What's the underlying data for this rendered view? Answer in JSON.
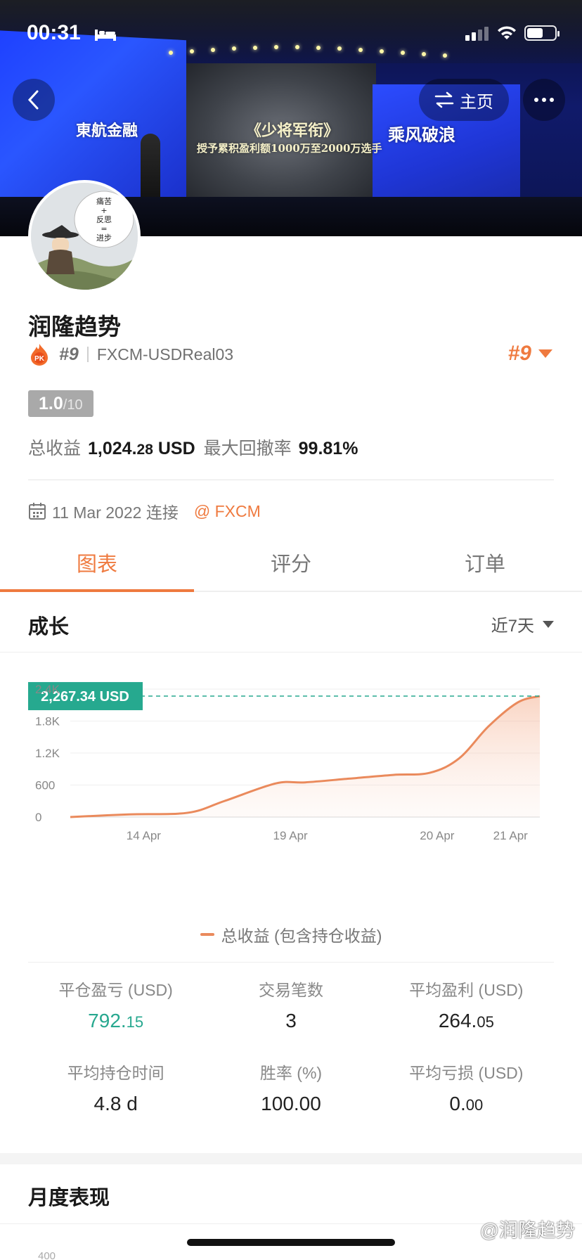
{
  "status_bar": {
    "time": "00:31"
  },
  "banner": {
    "left_text": "東航金融",
    "mid_text_1": "《少将军衔》",
    "mid_text_2": "授予累积盈利额1000万至2000万选手",
    "right_text": "乘风破浪"
  },
  "nav": {
    "home_label": "主页"
  },
  "avatar": {
    "bubble_text": "痛苦\n+\n反思\n=\n进步"
  },
  "profile": {
    "name": "润隆趋势",
    "rank": "#9",
    "server": "FXCM-USDReal03",
    "rank_right": "#9",
    "score_main": "1.0",
    "score_denom": "/10",
    "total_profit_label": "总收益",
    "total_profit_int": "1,024.",
    "total_profit_dec": "28",
    "total_profit_unit": " USD",
    "drawdown_label": "最大回撤率",
    "drawdown_value": "99.81%",
    "connect_text": "11 Mar 2022 连接",
    "broker": "@ FXCM"
  },
  "tabs": [
    {
      "label": "图表",
      "active": true
    },
    {
      "label": "评分",
      "active": false
    },
    {
      "label": "订单",
      "active": false
    }
  ],
  "growth": {
    "title": "成长",
    "range": "近7天",
    "legend": "总收益 (包含持仓收益)"
  },
  "chart_data": {
    "type": "area",
    "x": [
      "",
      "14 Apr",
      "",
      "19 Apr",
      "",
      "20 Apr",
      "21 Apr"
    ],
    "y_ticks": [
      "0",
      "600",
      "1.2K",
      "1.8K",
      "2.4K"
    ],
    "ylim": [
      0,
      2400
    ],
    "series": [
      {
        "name": "总收益 (包含持仓收益)",
        "points": [
          [
            0,
            0
          ],
          [
            0.8,
            50
          ],
          [
            1.6,
            80
          ],
          [
            2.1,
            300
          ],
          [
            2.8,
            630
          ],
          [
            3.2,
            650
          ],
          [
            3.8,
            720
          ],
          [
            4.4,
            790
          ],
          [
            4.9,
            830
          ],
          [
            5.3,
            1100
          ],
          [
            5.7,
            1700
          ],
          [
            6.1,
            2150
          ],
          [
            6.4,
            2267.34
          ]
        ]
      }
    ],
    "marker_label": "2,267.34 USD",
    "line_color": "#ea8a5c",
    "marker_color": "#26a98f"
  },
  "stats": [
    {
      "label": "平仓盈亏 (USD)",
      "int": "792.",
      "dec": "15",
      "green": true
    },
    {
      "label": "交易笔数",
      "int": "3",
      "dec": "",
      "green": false
    },
    {
      "label": "平均盈利 (USD)",
      "int": "264.",
      "dec": "05",
      "green": false
    },
    {
      "label": "平均持仓时间",
      "int": "4.8 d",
      "dec": "",
      "green": false
    },
    {
      "label": "胜率 (%)",
      "int": "100.00",
      "dec": "",
      "green": false
    },
    {
      "label": "平均亏损 (USD)",
      "int": "0.",
      "dec": "00",
      "green": false
    }
  ],
  "monthly": {
    "title": "月度表现",
    "partial_tick": "400"
  },
  "watermark": "@润隆趋势",
  "colors": {
    "accent": "#ef7a3f",
    "profit_green": "#27a88f"
  }
}
